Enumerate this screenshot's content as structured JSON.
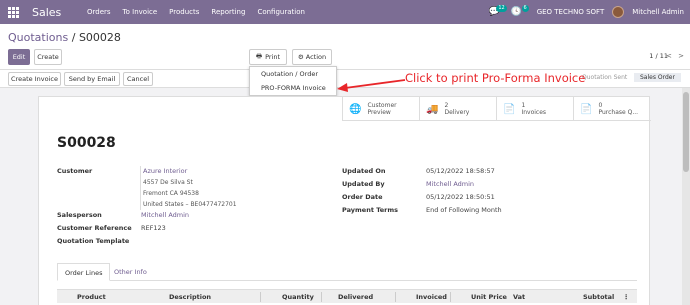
{
  "navbar": {
    "app_name": "Sales",
    "menu": [
      "Orders",
      "To Invoice",
      "Products",
      "Reporting",
      "Configuration"
    ],
    "chat_count": "12",
    "activity_count": "6",
    "company": "GEO TECHNO SOFT",
    "user": "Mitchell Admin"
  },
  "breadcrumb": {
    "parent": "Quotations",
    "separator": "/",
    "current": "S00028"
  },
  "buttons": {
    "edit": "Edit",
    "create": "Create",
    "print": "Print",
    "action": "Action",
    "create_invoice": "Create Invoice",
    "send_by_email": "Send by Email",
    "cancel": "Cancel"
  },
  "pager": {
    "value": "1 / 11",
    "prev": "<",
    "next": ">"
  },
  "print_menu": {
    "items": [
      "Quotation / Order",
      "PRO-FORMA Invoice"
    ]
  },
  "annotation": {
    "text": "Click to print Pro-Forma Invoice",
    "color": "#e8262a"
  },
  "statusbar": {
    "stages": [
      "Quotation Sent",
      "Sales Order"
    ],
    "active": "Sales Order"
  },
  "smart_buttons": [
    {
      "icon": "globe-icon",
      "glyph": "🌐",
      "line1": "Customer",
      "line2": "Preview"
    },
    {
      "icon": "truck-icon",
      "glyph": "🚚",
      "line1": "2",
      "line2": "Delivery"
    },
    {
      "icon": "invoice-icon",
      "glyph": "📄",
      "line1": "1",
      "line2": "Invoices"
    },
    {
      "icon": "purchase-icon",
      "glyph": "📄",
      "line1": "0",
      "line2": "Purchase Q..."
    }
  ],
  "record": {
    "name": "S00028",
    "customer_label": "Customer",
    "customer_lines": [
      "Azure Interior",
      "4557 De Silva St",
      "Fremont CA 94538",
      "United States – BE0477472701"
    ],
    "salesperson_label": "Salesperson",
    "salesperson": "Mitchell Admin",
    "customer_ref_label": "Customer Reference",
    "customer_ref": "REF123",
    "quotation_template_label": "Quotation Template",
    "updated_on_label": "Updated On",
    "updated_on": "05/12/2022 18:58:57",
    "updated_by_label": "Updated By",
    "updated_by": "Mitchell Admin",
    "order_date_label": "Order Date",
    "order_date": "05/12/2022 18:50:51",
    "payment_terms_label": "Payment Terms",
    "payment_terms": "End of Following Month"
  },
  "tabs": [
    "Order Lines",
    "Other Info"
  ],
  "table": {
    "columns": [
      "Product",
      "Description",
      "Quantity",
      "Delivered",
      "Invoiced",
      "Unit Price",
      "Vat",
      "Subtotal"
    ]
  },
  "colors": {
    "brand": "#7c6d94",
    "link": "#6f5d90",
    "accent": "#00a09d"
  }
}
